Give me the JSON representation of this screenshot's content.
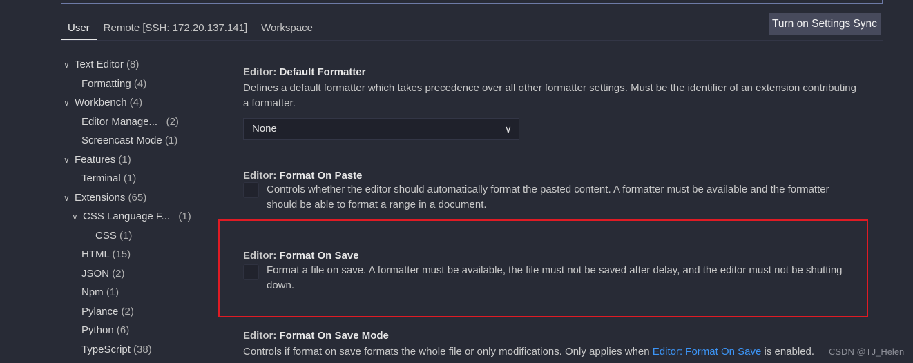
{
  "tabs": [
    {
      "label": "User",
      "active": true
    },
    {
      "label": "Remote [SSH: 172.20.137.141]"
    },
    {
      "label": "Workspace"
    }
  ],
  "sync_button": "Turn on Settings Sync",
  "tree": [
    {
      "label": "Text Editor",
      "count": "(8)",
      "level": 0,
      "expanded": true
    },
    {
      "label": "Formatting",
      "count": "(4)",
      "level": 1
    },
    {
      "label": "Workbench",
      "count": "(4)",
      "level": 0,
      "expanded": true
    },
    {
      "label": "Editor Manage...",
      "count": "  (2)",
      "level": 1
    },
    {
      "label": "Screencast Mode",
      "count": "(1)",
      "level": 1
    },
    {
      "label": "Features",
      "count": "(1)",
      "level": 0,
      "expanded": true
    },
    {
      "label": "Terminal",
      "count": "(1)",
      "level": 1
    },
    {
      "label": "Extensions",
      "count": "(65)",
      "level": 0,
      "expanded": true
    },
    {
      "label": "CSS Language F...",
      "count": "  (1)",
      "level": 1,
      "expanded": true
    },
    {
      "label": "CSS",
      "count": "(1)",
      "level": 2
    },
    {
      "label": "HTML",
      "count": "(15)",
      "level": 1
    },
    {
      "label": "JSON",
      "count": "(2)",
      "level": 1
    },
    {
      "label": "Npm",
      "count": "(1)",
      "level": 1
    },
    {
      "label": "Pylance",
      "count": "(2)",
      "level": 1
    },
    {
      "label": "Python",
      "count": "(6)",
      "level": 1
    },
    {
      "label": "TypeScript",
      "count": "(38)",
      "level": 1
    }
  ],
  "settings": {
    "default_formatter": {
      "category": "Editor: ",
      "name": "Default Formatter",
      "description": "Defines a default formatter which takes precedence over all other formatter settings. Must be the identifier of an extension contributing a formatter.",
      "value": "None"
    },
    "format_on_paste": {
      "category": "Editor: ",
      "name": "Format On Paste",
      "description": "Controls whether the editor should automatically format the pasted content. A formatter must be available and the formatter should be able to format a range in a document.",
      "checked": false
    },
    "format_on_save": {
      "category": "Editor: ",
      "name": "Format On Save",
      "description": "Format a file on save. A formatter must be available, the file must not be saved after delay, and the editor must not be shutting down.",
      "checked": false
    },
    "format_on_save_mode": {
      "category": "Editor: ",
      "name": "Format On Save Mode",
      "description_pre": "Controls if format on save formats the whole file or only modifications. Only applies when ",
      "link": "Editor: Format On Save",
      "description_post": " is enabled."
    }
  },
  "watermark": "CSDN @TJ_Helen",
  "colors": {
    "background": "#282b36",
    "highlight": "#e01b24",
    "link": "#3c94f5"
  }
}
